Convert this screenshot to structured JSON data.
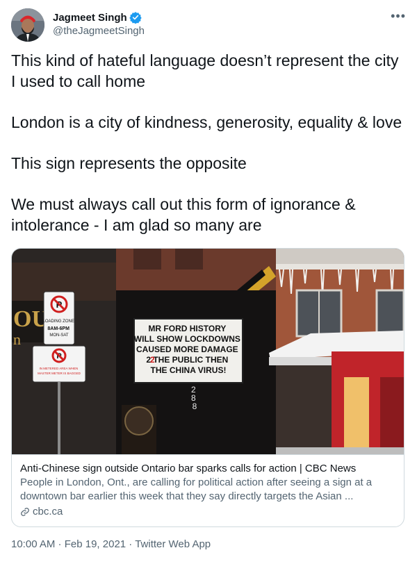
{
  "author": {
    "display_name": "Jagmeet Singh",
    "handle": "@theJagmeetSingh",
    "avatar_icon": "profile-photo",
    "verified_icon": "verified-badge-icon",
    "verified_color": "#1d9bf0"
  },
  "more_icon": "more-options-icon",
  "tweet": {
    "paragraphs": [
      "This kind of hateful language doesn’t represent the city I used to call home",
      "London is a city of kindness, generosity, equality & love",
      "This sign represents the opposite",
      "We must always call out this form of ignorance & intolerance - I am glad so many are"
    ]
  },
  "card": {
    "image": {
      "sign_lines": [
        "MR FORD  HISTORY",
        "WILL SHOW LOCKDOWNS",
        "CAUSED MORE DAMAGE",
        "2  THE PUBLIC  THEN",
        "THE CHINA VIRUS!"
      ],
      "sign_red_char": "2",
      "loading_zone": [
        "LOADING ZONE",
        "8AM-6PM",
        "MON-SAT"
      ],
      "meter_sign": [
        "IN METERED AREA WHEN",
        "MASTER METER IS BAGGED"
      ],
      "address_number": [
        "2",
        "8",
        "8"
      ],
      "letters": "OU",
      "letter_small": "n"
    },
    "title": "Anti-Chinese sign outside Ontario bar sparks calls for action | CBC News",
    "description": "People in London, Ont., are calling for political action after seeing a sign at a downtown bar earlier this week that they say directly targets the Asian ...",
    "domain": "cbc.ca",
    "domain_icon": "link-icon"
  },
  "meta": {
    "time": "10:00 AM",
    "separator": " · ",
    "date": "Feb 19, 2021",
    "source": "Twitter Web App"
  }
}
